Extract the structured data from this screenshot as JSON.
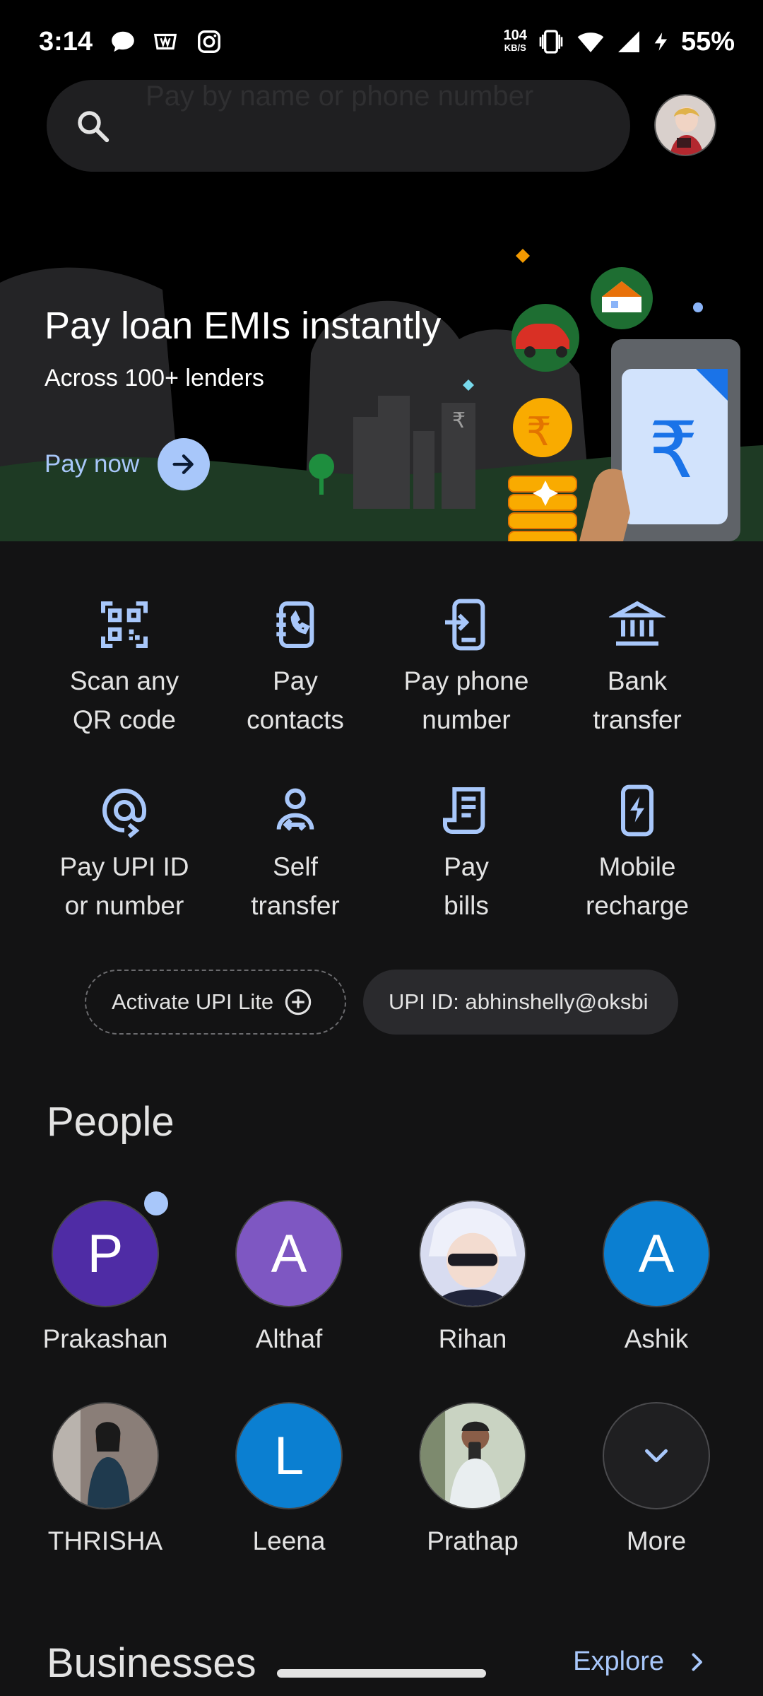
{
  "status_bar": {
    "time": "3:14",
    "net_speed": "104",
    "net_unit": "KB/S",
    "battery": "55%"
  },
  "search": {
    "placeholder": "Pay by name or phone number"
  },
  "banner": {
    "title": "Pay loan EMIs instantly",
    "subtitle": "Across 100+ lenders",
    "cta": "Pay now",
    "coin_symbol": "₹"
  },
  "actions": [
    {
      "label1": "Scan any",
      "label2": "QR code",
      "icon": "qr-scan-icon"
    },
    {
      "label1": "Pay",
      "label2": "contacts",
      "icon": "contacts-icon"
    },
    {
      "label1": "Pay phone",
      "label2": "number",
      "icon": "phone-transfer-icon"
    },
    {
      "label1": "Bank",
      "label2": "transfer",
      "icon": "bank-icon"
    },
    {
      "label1": "Pay UPI ID",
      "label2": "or number",
      "icon": "at-sign-icon"
    },
    {
      "label1": "Self",
      "label2": "transfer",
      "icon": "self-transfer-icon"
    },
    {
      "label1": "Pay",
      "label2": "bills",
      "icon": "bill-icon"
    },
    {
      "label1": "Mobile",
      "label2": "recharge",
      "icon": "mobile-recharge-icon"
    }
  ],
  "chips": {
    "upi_lite": "Activate UPI Lite",
    "upi_id": "UPI ID: abhinshelly@oksbi"
  },
  "people": {
    "title": "People",
    "items": [
      {
        "name": "Prakashan",
        "initial": "P",
        "color": "#4f2ca5"
      },
      {
        "name": "Althaf",
        "initial": "A",
        "color": "#7e57c2"
      },
      {
        "name": "Rihan",
        "initial": "",
        "color": "#2b2f4a"
      },
      {
        "name": "Ashik",
        "initial": "A",
        "color": "#0b7fd1"
      },
      {
        "name": "THRISHA",
        "initial": "",
        "color": "#5b4a45"
      },
      {
        "name": "Leena",
        "initial": "L",
        "color": "#0b7fd1"
      },
      {
        "name": "Prathap",
        "initial": "",
        "color": "#6f7a6a"
      },
      {
        "name": "More",
        "initial": "",
        "color": "#1f1f21"
      }
    ]
  },
  "businesses": {
    "title": "Businesses",
    "explore": "Explore"
  },
  "colors": {
    "accent": "#a8c7fa",
    "background": "#131314"
  }
}
